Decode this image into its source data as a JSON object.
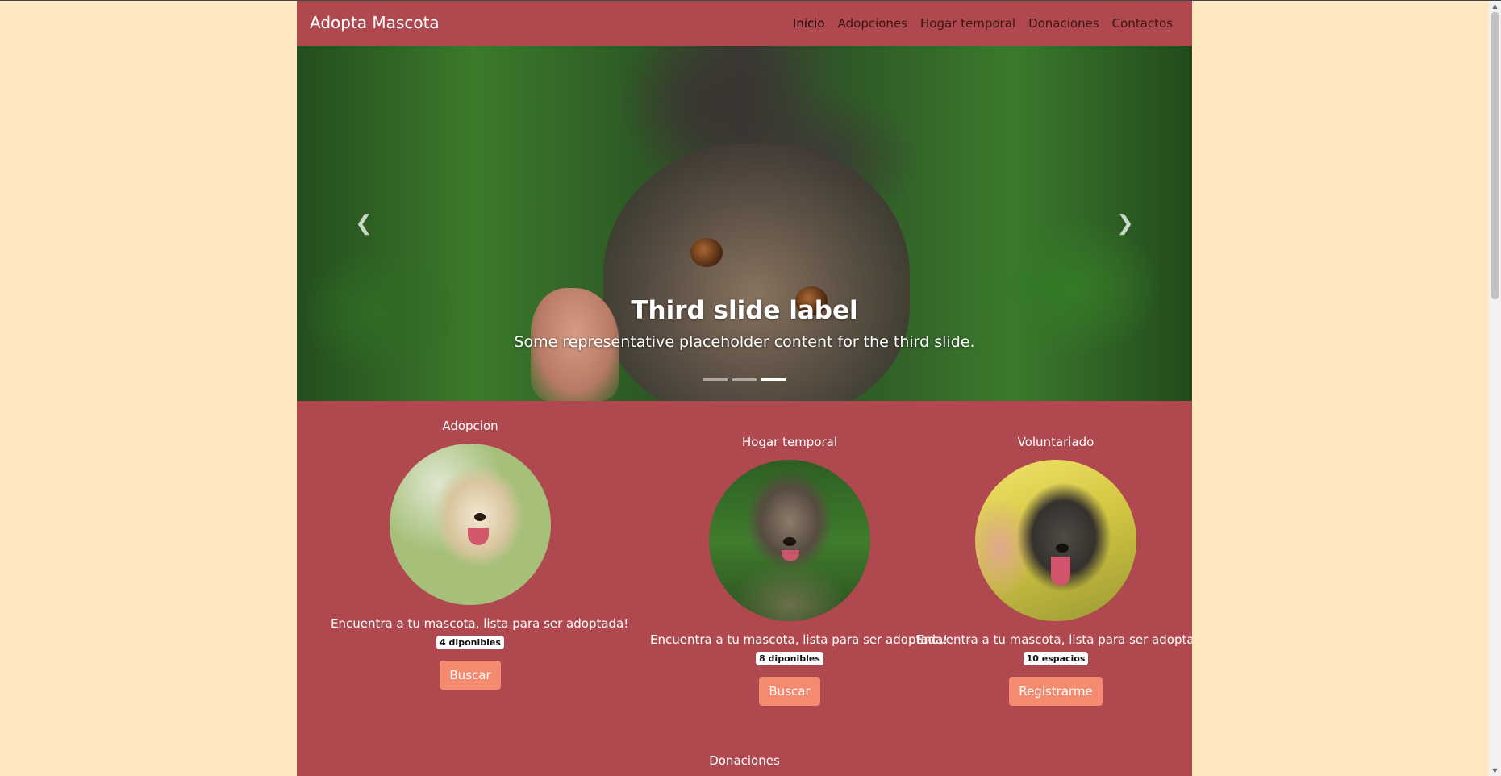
{
  "navbar": {
    "brand": "Adopta Mascota",
    "links": [
      "Inicio",
      "Adopciones",
      "Hogar temporal",
      "Donaciones",
      "Contactos"
    ]
  },
  "carousel": {
    "title": "Third slide label",
    "text": "Some representative placeholder content for the third slide.",
    "prev_icon": "chevron-left-icon",
    "next_icon": "chevron-right-icon",
    "slide_count": 3,
    "active_slide": 3
  },
  "cards": [
    {
      "title": "Adopcion",
      "text": "Encuentra a tu mascota, lista para ser adoptada!",
      "badge": "4 diponibles",
      "button": "Buscar"
    },
    {
      "title": "Hogar temporal",
      "text": "Encuentra a tu mascota, lista para ser adoptada!",
      "badge": "8 diponibles",
      "button": "Buscar"
    },
    {
      "title": "Voluntariado",
      "text": "Encuentra a tu mascota, lista para ser adoptada!",
      "badge": "10 espacios",
      "button": "Registrarme"
    }
  ],
  "sections": {
    "donations_title": "Donaciones"
  },
  "colors": {
    "page_background": "#ffe8c0",
    "container_background": "#b0494f",
    "button": "#f58b6e"
  }
}
